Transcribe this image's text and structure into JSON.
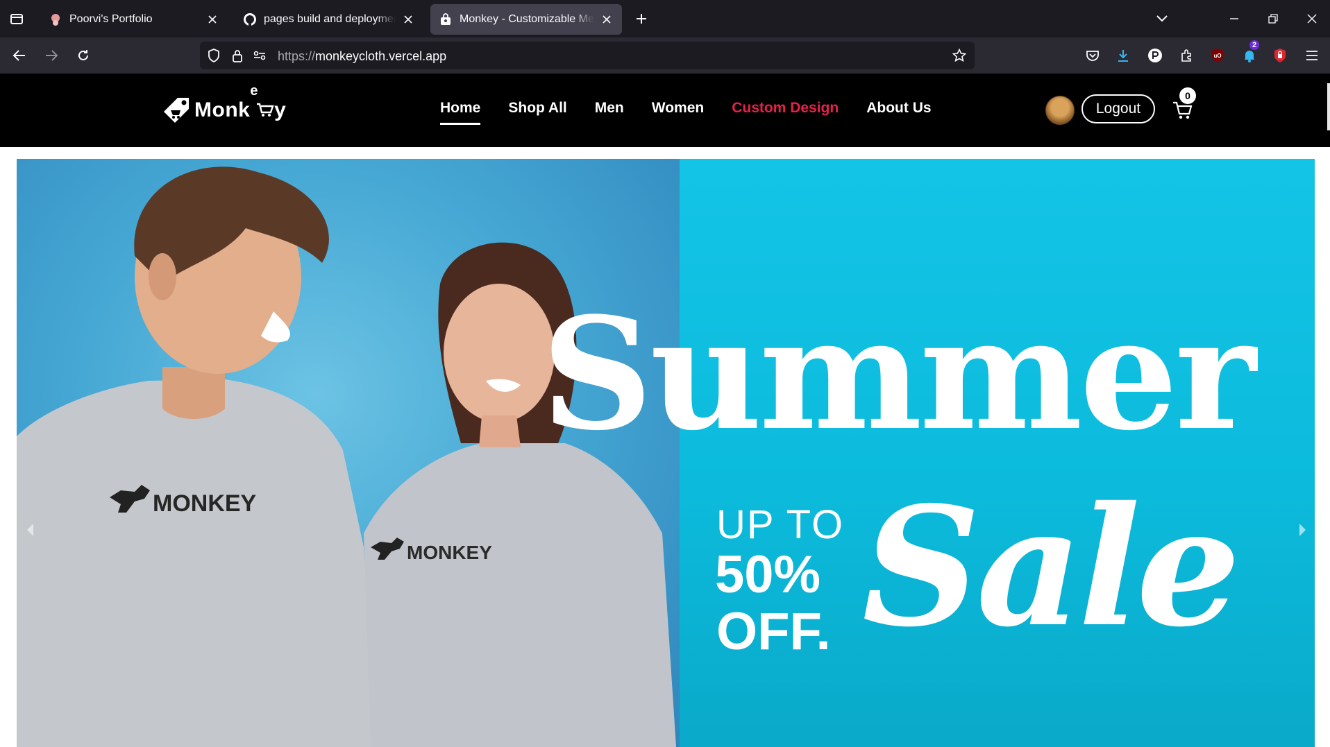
{
  "browser": {
    "tabs": [
      {
        "label": "Poorvi's Portfolio",
        "active": false
      },
      {
        "label": "pages build and deployment · poorvi",
        "active": false
      },
      {
        "label": "Monkey - Customizable Men's and Women's",
        "active": true
      }
    ],
    "url": {
      "protocol": "https://",
      "host": "monkeycloth.vercel.app"
    },
    "extension_badge": "2"
  },
  "site": {
    "logo_text": "Monk",
    "logo_text_tail": "y",
    "logo_text_e": "e",
    "nav": [
      {
        "label": "Home",
        "active": true,
        "accent": false
      },
      {
        "label": "Shop All",
        "active": false,
        "accent": false
      },
      {
        "label": "Men",
        "active": false,
        "accent": false
      },
      {
        "label": "Women",
        "active": false,
        "accent": false
      },
      {
        "label": "Custom Design",
        "active": false,
        "accent": true
      },
      {
        "label": "About Us",
        "active": false,
        "accent": false
      }
    ],
    "logout_label": "Logout",
    "cart_count": "0",
    "accent_color": "#e8204b"
  },
  "hero": {
    "title_word1": "Summer",
    "title_word2": "Sale",
    "upto": "UP TO",
    "percent": "50%",
    "off": "OFF.",
    "shirt_brand_left": "MONKEY",
    "shirt_brand_right": "MONKEY",
    "background_left": "#4aa7d1",
    "background_right": "#0cbbdc"
  }
}
